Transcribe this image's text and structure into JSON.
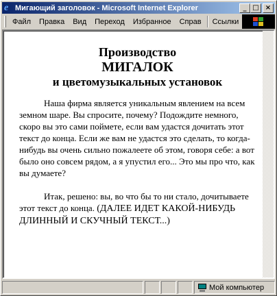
{
  "window": {
    "title": "Мигающий заголовок - Microsoft Internet Explorer"
  },
  "title_buttons": {
    "minimize": "_",
    "maximize": "□",
    "close": "×"
  },
  "menu": {
    "items": [
      "Файл",
      "Правка",
      "Вид",
      "Переход",
      "Избранное",
      "Справ"
    ],
    "links": "Ссылки"
  },
  "content": {
    "heading_line1": "Производство",
    "heading_line2": "МИГАЛОК",
    "heading_line3": "и цветомузыкальных установок",
    "paragraph1": "Наша фирма является уникальным явлением на всем земном шаре. Вы спросите, почему? Подождите немного, скоро вы это сами поймете, если вам удастся дочитать этот текст до конца. Если же вам не удастся это сделать, то когда-нибудь вы очень сильно пожалеете об этом, говоря себе: а вот было оно совсем рядом, а я упустил его... Это мы про что, как вы думаете?",
    "paragraph2_start": "Итак, решено: вы, во что бы то ни стало, дочитываете этот текст до конца.",
    "paragraph2_end": "(ДАЛЕЕ ИДЕТ КАКОЙ-НИБУДЬ ДЛИННЫЙ И СКУЧНЫЙ ТЕКСТ...)"
  },
  "status": {
    "zone": "Мой компьютер"
  },
  "colors": {
    "titlebar_start": "#0a246a",
    "titlebar_end": "#a6caf0",
    "chrome": "#d4d0c8"
  },
  "icons": {
    "title": "ie-icon",
    "throbber": "windows-logo-icon",
    "zone": "computer-icon"
  }
}
